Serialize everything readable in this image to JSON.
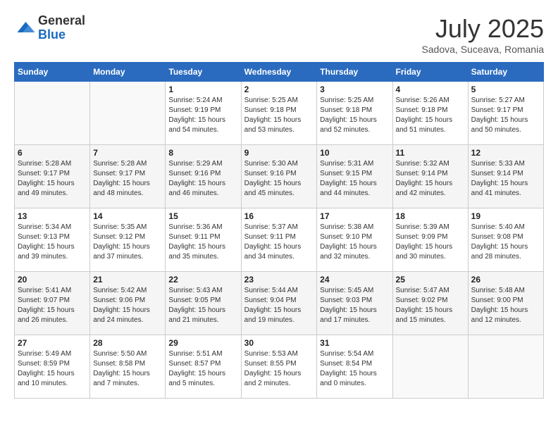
{
  "logo": {
    "line1": "General",
    "line2": "Blue"
  },
  "title": "July 2025",
  "subtitle": "Sadova, Suceava, Romania",
  "weekdays": [
    "Sunday",
    "Monday",
    "Tuesday",
    "Wednesday",
    "Thursday",
    "Friday",
    "Saturday"
  ],
  "weeks": [
    [
      {
        "day": "",
        "info": ""
      },
      {
        "day": "",
        "info": ""
      },
      {
        "day": "1",
        "info": "Sunrise: 5:24 AM\nSunset: 9:19 PM\nDaylight: 15 hours\nand 54 minutes."
      },
      {
        "day": "2",
        "info": "Sunrise: 5:25 AM\nSunset: 9:18 PM\nDaylight: 15 hours\nand 53 minutes."
      },
      {
        "day": "3",
        "info": "Sunrise: 5:25 AM\nSunset: 9:18 PM\nDaylight: 15 hours\nand 52 minutes."
      },
      {
        "day": "4",
        "info": "Sunrise: 5:26 AM\nSunset: 9:18 PM\nDaylight: 15 hours\nand 51 minutes."
      },
      {
        "day": "5",
        "info": "Sunrise: 5:27 AM\nSunset: 9:17 PM\nDaylight: 15 hours\nand 50 minutes."
      }
    ],
    [
      {
        "day": "6",
        "info": "Sunrise: 5:28 AM\nSunset: 9:17 PM\nDaylight: 15 hours\nand 49 minutes."
      },
      {
        "day": "7",
        "info": "Sunrise: 5:28 AM\nSunset: 9:17 PM\nDaylight: 15 hours\nand 48 minutes."
      },
      {
        "day": "8",
        "info": "Sunrise: 5:29 AM\nSunset: 9:16 PM\nDaylight: 15 hours\nand 46 minutes."
      },
      {
        "day": "9",
        "info": "Sunrise: 5:30 AM\nSunset: 9:16 PM\nDaylight: 15 hours\nand 45 minutes."
      },
      {
        "day": "10",
        "info": "Sunrise: 5:31 AM\nSunset: 9:15 PM\nDaylight: 15 hours\nand 44 minutes."
      },
      {
        "day": "11",
        "info": "Sunrise: 5:32 AM\nSunset: 9:14 PM\nDaylight: 15 hours\nand 42 minutes."
      },
      {
        "day": "12",
        "info": "Sunrise: 5:33 AM\nSunset: 9:14 PM\nDaylight: 15 hours\nand 41 minutes."
      }
    ],
    [
      {
        "day": "13",
        "info": "Sunrise: 5:34 AM\nSunset: 9:13 PM\nDaylight: 15 hours\nand 39 minutes."
      },
      {
        "day": "14",
        "info": "Sunrise: 5:35 AM\nSunset: 9:12 PM\nDaylight: 15 hours\nand 37 minutes."
      },
      {
        "day": "15",
        "info": "Sunrise: 5:36 AM\nSunset: 9:11 PM\nDaylight: 15 hours\nand 35 minutes."
      },
      {
        "day": "16",
        "info": "Sunrise: 5:37 AM\nSunset: 9:11 PM\nDaylight: 15 hours\nand 34 minutes."
      },
      {
        "day": "17",
        "info": "Sunrise: 5:38 AM\nSunset: 9:10 PM\nDaylight: 15 hours\nand 32 minutes."
      },
      {
        "day": "18",
        "info": "Sunrise: 5:39 AM\nSunset: 9:09 PM\nDaylight: 15 hours\nand 30 minutes."
      },
      {
        "day": "19",
        "info": "Sunrise: 5:40 AM\nSunset: 9:08 PM\nDaylight: 15 hours\nand 28 minutes."
      }
    ],
    [
      {
        "day": "20",
        "info": "Sunrise: 5:41 AM\nSunset: 9:07 PM\nDaylight: 15 hours\nand 26 minutes."
      },
      {
        "day": "21",
        "info": "Sunrise: 5:42 AM\nSunset: 9:06 PM\nDaylight: 15 hours\nand 24 minutes."
      },
      {
        "day": "22",
        "info": "Sunrise: 5:43 AM\nSunset: 9:05 PM\nDaylight: 15 hours\nand 21 minutes."
      },
      {
        "day": "23",
        "info": "Sunrise: 5:44 AM\nSunset: 9:04 PM\nDaylight: 15 hours\nand 19 minutes."
      },
      {
        "day": "24",
        "info": "Sunrise: 5:45 AM\nSunset: 9:03 PM\nDaylight: 15 hours\nand 17 minutes."
      },
      {
        "day": "25",
        "info": "Sunrise: 5:47 AM\nSunset: 9:02 PM\nDaylight: 15 hours\nand 15 minutes."
      },
      {
        "day": "26",
        "info": "Sunrise: 5:48 AM\nSunset: 9:00 PM\nDaylight: 15 hours\nand 12 minutes."
      }
    ],
    [
      {
        "day": "27",
        "info": "Sunrise: 5:49 AM\nSunset: 8:59 PM\nDaylight: 15 hours\nand 10 minutes."
      },
      {
        "day": "28",
        "info": "Sunrise: 5:50 AM\nSunset: 8:58 PM\nDaylight: 15 hours\nand 7 minutes."
      },
      {
        "day": "29",
        "info": "Sunrise: 5:51 AM\nSunset: 8:57 PM\nDaylight: 15 hours\nand 5 minutes."
      },
      {
        "day": "30",
        "info": "Sunrise: 5:53 AM\nSunset: 8:55 PM\nDaylight: 15 hours\nand 2 minutes."
      },
      {
        "day": "31",
        "info": "Sunrise: 5:54 AM\nSunset: 8:54 PM\nDaylight: 15 hours\nand 0 minutes."
      },
      {
        "day": "",
        "info": ""
      },
      {
        "day": "",
        "info": ""
      }
    ]
  ]
}
